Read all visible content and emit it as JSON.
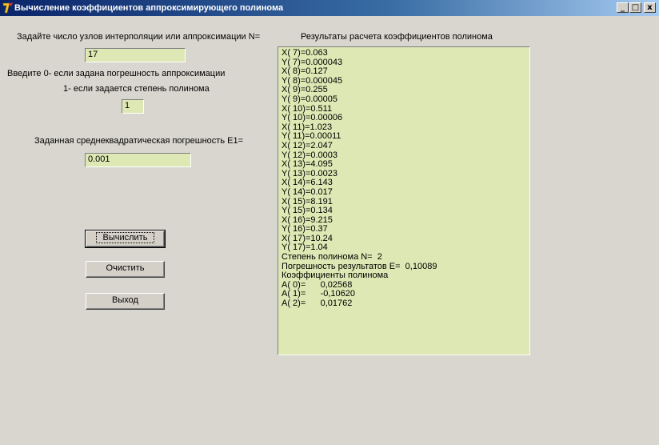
{
  "window": {
    "title": "Вычисление коэффициентов аппроксимирующего полинома",
    "minimize_glyph": "_",
    "maximize_glyph": "□",
    "close_glyph": "x"
  },
  "form": {
    "nodes_label": "Задайте число узлов интерполяции или аппроксимации N=",
    "nodes_value": "17",
    "mode_label_1": "Введите 0- если задана погрешность аппроксимации",
    "mode_label_2": "1- если задается степень полинома",
    "mode_value": "1",
    "error_label": "Заданная среднеквадратическая погрешность E1=",
    "error_value": "0.001"
  },
  "buttons": {
    "compute": "Вычислить",
    "clear": "Очистить",
    "exit": "Выход"
  },
  "results": {
    "header": "Результаты расчета коэффициентов полинома",
    "lines": [
      "X( 7)=0.063",
      "Y( 7)=0.000043",
      "X( 8)=0.127",
      "Y( 8)=0.000045",
      "X( 9)=0.255",
      "Y( 9)=0.00005",
      "X( 10)=0.511",
      "Y( 10)=0.00006",
      "X( 11)=1.023",
      "Y( 11)=0.00011",
      "X( 12)=2.047",
      "Y( 12)=0.0003",
      "X( 13)=4.095",
      "Y( 13)=0.0023",
      "X( 14)=6.143",
      "Y( 14)=0.017",
      "X( 15)=8.191",
      "Y( 15)=0.134",
      "X( 16)=9.215",
      "Y( 16)=0.37",
      "X( 17)=10.24",
      "Y( 17)=1.04",
      "Степень полинома N=  2",
      "Погрешность результатов E=  0,10089",
      "Коэффициенты полинома",
      "A( 0)=      0,02568",
      "A( 1)=      -0,10620",
      "A( 2)=      0,01762"
    ]
  },
  "colors": {
    "background": "#d8d6ce",
    "field": "#dde8b4",
    "titlebar": "#0a246a"
  }
}
